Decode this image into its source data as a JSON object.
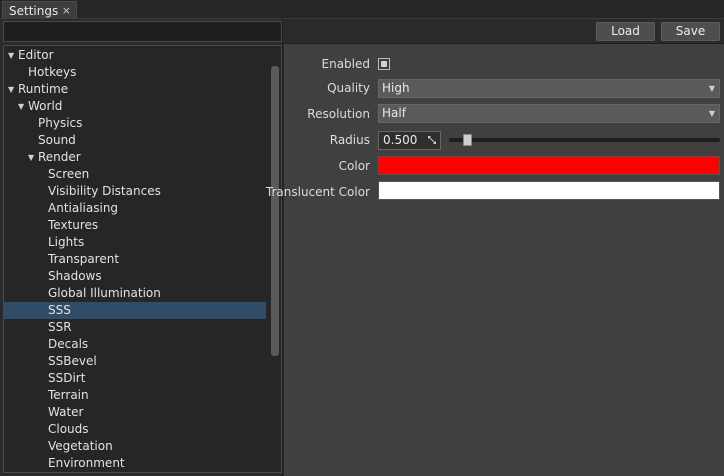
{
  "tab": {
    "label": "Settings",
    "close": "×"
  },
  "toolbar": {
    "load_label": "Load",
    "save_label": "Save"
  },
  "tree": {
    "selected_index": 15,
    "items": [
      {
        "label": "Editor",
        "level": 0,
        "expanded": true
      },
      {
        "label": "Hotkeys",
        "level": 1,
        "expanded": null
      },
      {
        "label": "Runtime",
        "level": 0,
        "expanded": true
      },
      {
        "label": "World",
        "level": 1,
        "expanded": true
      },
      {
        "label": "Physics",
        "level": 2,
        "expanded": null
      },
      {
        "label": "Sound",
        "level": 2,
        "expanded": null
      },
      {
        "label": "Render",
        "level": 2,
        "expanded": true
      },
      {
        "label": "Screen",
        "level": 3,
        "expanded": null
      },
      {
        "label": "Visibility Distances",
        "level": 3,
        "expanded": null
      },
      {
        "label": "Antialiasing",
        "level": 3,
        "expanded": null
      },
      {
        "label": "Textures",
        "level": 3,
        "expanded": null
      },
      {
        "label": "Lights",
        "level": 3,
        "expanded": null
      },
      {
        "label": "Transparent",
        "level": 3,
        "expanded": null
      },
      {
        "label": "Shadows",
        "level": 3,
        "expanded": null
      },
      {
        "label": "Global Illumination",
        "level": 3,
        "expanded": null
      },
      {
        "label": "SSS",
        "level": 3,
        "expanded": null
      },
      {
        "label": "SSR",
        "level": 3,
        "expanded": null
      },
      {
        "label": "Decals",
        "level": 3,
        "expanded": null
      },
      {
        "label": "SSBevel",
        "level": 3,
        "expanded": null
      },
      {
        "label": "SSDirt",
        "level": 3,
        "expanded": null
      },
      {
        "label": "Terrain",
        "level": 3,
        "expanded": null
      },
      {
        "label": "Water",
        "level": 3,
        "expanded": null
      },
      {
        "label": "Clouds",
        "level": 3,
        "expanded": null
      },
      {
        "label": "Vegetation",
        "level": 3,
        "expanded": null
      },
      {
        "label": "Environment",
        "level": 3,
        "expanded": null
      }
    ]
  },
  "properties": {
    "enabled": {
      "label": "Enabled",
      "checked": true
    },
    "quality": {
      "label": "Quality",
      "value": "High"
    },
    "resolution": {
      "label": "Resolution",
      "value": "Half"
    },
    "radius": {
      "label": "Radius",
      "value": "0.500",
      "slider_fraction": 0.05
    },
    "color": {
      "label": "Color",
      "hex": "#ff0000"
    },
    "translucent_color": {
      "label": "Translucent Color",
      "hex": "#ffffff"
    }
  },
  "colors": {
    "selection": "#2f4d66",
    "background": "#2b2b2b",
    "panel": "#404040"
  }
}
